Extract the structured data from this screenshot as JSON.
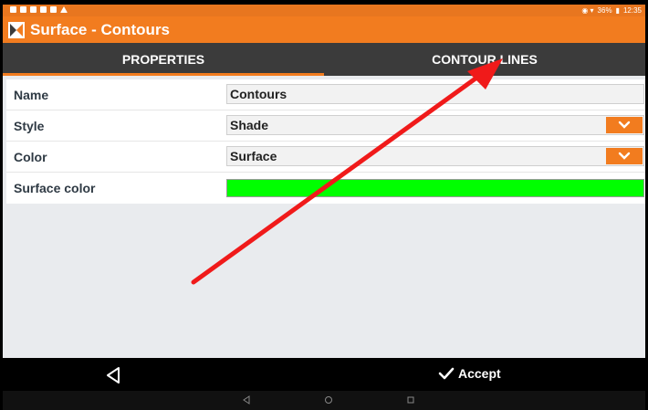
{
  "status": {
    "battery": "36%",
    "time": "12:35"
  },
  "app": {
    "title": "Surface - Contours"
  },
  "tabs": [
    {
      "label": "PROPERTIES",
      "active": true
    },
    {
      "label": "CONTOUR LINES",
      "active": false
    }
  ],
  "form": {
    "name": {
      "label": "Name",
      "value": "Contours"
    },
    "style": {
      "label": "Style",
      "value": "Shade"
    },
    "color": {
      "label": "Color",
      "value": "Surface"
    },
    "surface_color": {
      "label": "Surface color",
      "value": "#00ff00"
    }
  },
  "actions": {
    "accept_label": "Accept"
  },
  "colors": {
    "accent": "#f27c1f",
    "annotation_arrow": "#f01a1a"
  }
}
